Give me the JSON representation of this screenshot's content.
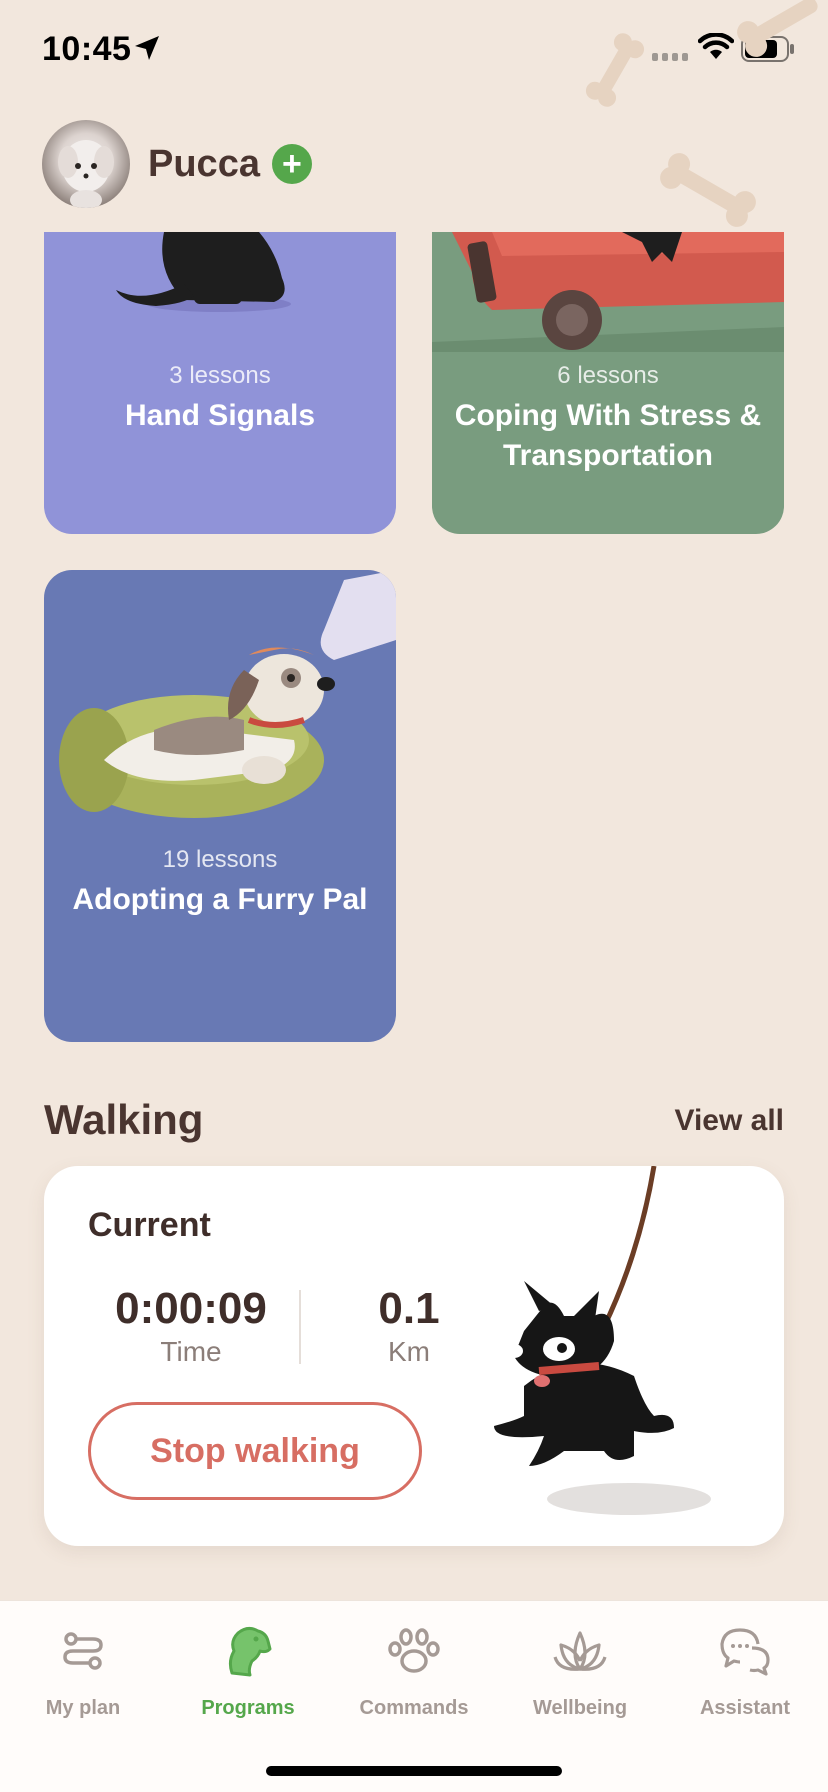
{
  "status_bar": {
    "time": "10:45",
    "icons": [
      "location-arrow-icon",
      "signal-icon",
      "wifi-icon",
      "battery-icon"
    ]
  },
  "profile": {
    "pet_name": "Pucca",
    "add_label": "+"
  },
  "programs": [
    {
      "lessons": "3 lessons",
      "title": "Hand Signals",
      "color": "#9093D8"
    },
    {
      "lessons": "6 lessons",
      "title": "Coping With Stress & Transportation",
      "color": "#799C7F"
    },
    {
      "lessons": "19 lessons",
      "title": "Adopting a Furry Pal",
      "color": "#6879B4"
    }
  ],
  "walking": {
    "section_title": "Walking",
    "view_all": "View all",
    "current_label": "Current",
    "time_value": "0:00:09",
    "time_label": "Time",
    "distance_value": "0.1",
    "distance_label": "Km",
    "stop_button": "Stop walking"
  },
  "tabs": [
    {
      "label": "My plan",
      "icon": "route-icon",
      "active": false
    },
    {
      "label": "Programs",
      "icon": "dog-head-icon",
      "active": true
    },
    {
      "label": "Commands",
      "icon": "paw-icon",
      "active": false
    },
    {
      "label": "Wellbeing",
      "icon": "lotus-icon",
      "active": false
    },
    {
      "label": "Assistant",
      "icon": "chat-bubbles-icon",
      "active": false
    }
  ],
  "colors": {
    "background": "#F2E7DD",
    "accent_green": "#55A74B",
    "stop_red": "#D76E63",
    "text_dark": "#4A3530",
    "tab_inactive": "#A59A95"
  }
}
